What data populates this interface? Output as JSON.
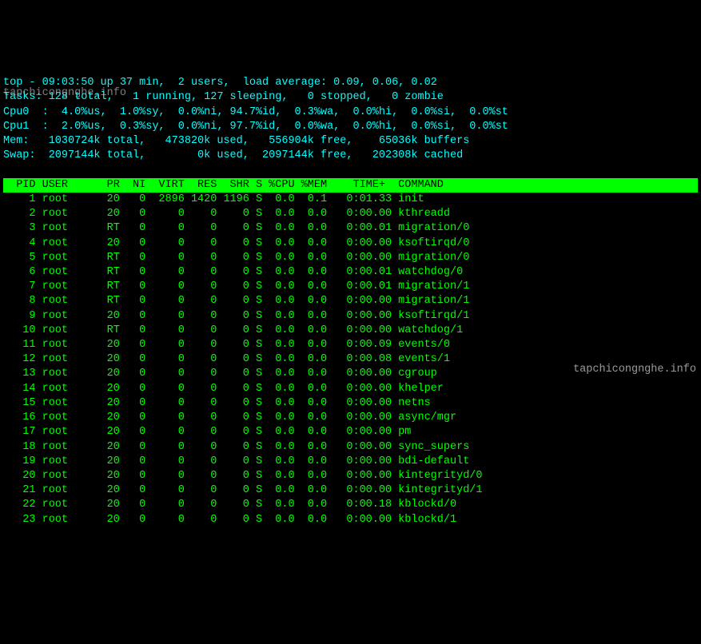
{
  "summary": {
    "line1": "top - 09:03:50 up 37 min,  2 users,  load average: 0.09, 0.06, 0.02",
    "line2": "Tasks: 128 total,   1 running, 127 sleeping,   0 stopped,   0 zombie",
    "line3": "Cpu0  :  4.0%us,  1.0%sy,  0.0%ni, 94.7%id,  0.3%wa,  0.0%hi,  0.0%si,  0.0%st",
    "line4": "Cpu1  :  2.0%us,  0.3%sy,  0.0%ni, 97.7%id,  0.0%wa,  0.0%hi,  0.0%si,  0.0%st",
    "line5": "Mem:   1030724k total,   473820k used,   556904k free,    65036k buffers",
    "line6": "Swap:  2097144k total,        0k used,  2097144k free,   202308k cached"
  },
  "header": "  PID USER      PR  NI  VIRT  RES  SHR S %CPU %MEM    TIME+  COMMAND           ",
  "rows": [
    {
      "pid": "1",
      "user": "root",
      "pr": "20",
      "ni": "0",
      "virt": "2896",
      "res": "1420",
      "shr": "1196",
      "s": "S",
      "cpu": "0.0",
      "mem": "0.1",
      "time": "0:01.33",
      "cmd": "init"
    },
    {
      "pid": "2",
      "user": "root",
      "pr": "20",
      "ni": "0",
      "virt": "0",
      "res": "0",
      "shr": "0",
      "s": "S",
      "cpu": "0.0",
      "mem": "0.0",
      "time": "0:00.00",
      "cmd": "kthreadd"
    },
    {
      "pid": "3",
      "user": "root",
      "pr": "RT",
      "ni": "0",
      "virt": "0",
      "res": "0",
      "shr": "0",
      "s": "S",
      "cpu": "0.0",
      "mem": "0.0",
      "time": "0:00.01",
      "cmd": "migration/0"
    },
    {
      "pid": "4",
      "user": "root",
      "pr": "20",
      "ni": "0",
      "virt": "0",
      "res": "0",
      "shr": "0",
      "s": "S",
      "cpu": "0.0",
      "mem": "0.0",
      "time": "0:00.00",
      "cmd": "ksoftirqd/0"
    },
    {
      "pid": "5",
      "user": "root",
      "pr": "RT",
      "ni": "0",
      "virt": "0",
      "res": "0",
      "shr": "0",
      "s": "S",
      "cpu": "0.0",
      "mem": "0.0",
      "time": "0:00.00",
      "cmd": "migration/0"
    },
    {
      "pid": "6",
      "user": "root",
      "pr": "RT",
      "ni": "0",
      "virt": "0",
      "res": "0",
      "shr": "0",
      "s": "S",
      "cpu": "0.0",
      "mem": "0.0",
      "time": "0:00.01",
      "cmd": "watchdog/0"
    },
    {
      "pid": "7",
      "user": "root",
      "pr": "RT",
      "ni": "0",
      "virt": "0",
      "res": "0",
      "shr": "0",
      "s": "S",
      "cpu": "0.0",
      "mem": "0.0",
      "time": "0:00.01",
      "cmd": "migration/1"
    },
    {
      "pid": "8",
      "user": "root",
      "pr": "RT",
      "ni": "0",
      "virt": "0",
      "res": "0",
      "shr": "0",
      "s": "S",
      "cpu": "0.0",
      "mem": "0.0",
      "time": "0:00.00",
      "cmd": "migration/1"
    },
    {
      "pid": "9",
      "user": "root",
      "pr": "20",
      "ni": "0",
      "virt": "0",
      "res": "0",
      "shr": "0",
      "s": "S",
      "cpu": "0.0",
      "mem": "0.0",
      "time": "0:00.00",
      "cmd": "ksoftirqd/1"
    },
    {
      "pid": "10",
      "user": "root",
      "pr": "RT",
      "ni": "0",
      "virt": "0",
      "res": "0",
      "shr": "0",
      "s": "S",
      "cpu": "0.0",
      "mem": "0.0",
      "time": "0:00.00",
      "cmd": "watchdog/1"
    },
    {
      "pid": "11",
      "user": "root",
      "pr": "20",
      "ni": "0",
      "virt": "0",
      "res": "0",
      "shr": "0",
      "s": "S",
      "cpu": "0.0",
      "mem": "0.0",
      "time": "0:00.09",
      "cmd": "events/0"
    },
    {
      "pid": "12",
      "user": "root",
      "pr": "20",
      "ni": "0",
      "virt": "0",
      "res": "0",
      "shr": "0",
      "s": "S",
      "cpu": "0.0",
      "mem": "0.0",
      "time": "0:00.08",
      "cmd": "events/1"
    },
    {
      "pid": "13",
      "user": "root",
      "pr": "20",
      "ni": "0",
      "virt": "0",
      "res": "0",
      "shr": "0",
      "s": "S",
      "cpu": "0.0",
      "mem": "0.0",
      "time": "0:00.00",
      "cmd": "cgroup"
    },
    {
      "pid": "14",
      "user": "root",
      "pr": "20",
      "ni": "0",
      "virt": "0",
      "res": "0",
      "shr": "0",
      "s": "S",
      "cpu": "0.0",
      "mem": "0.0",
      "time": "0:00.00",
      "cmd": "khelper"
    },
    {
      "pid": "15",
      "user": "root",
      "pr": "20",
      "ni": "0",
      "virt": "0",
      "res": "0",
      "shr": "0",
      "s": "S",
      "cpu": "0.0",
      "mem": "0.0",
      "time": "0:00.00",
      "cmd": "netns"
    },
    {
      "pid": "16",
      "user": "root",
      "pr": "20",
      "ni": "0",
      "virt": "0",
      "res": "0",
      "shr": "0",
      "s": "S",
      "cpu": "0.0",
      "mem": "0.0",
      "time": "0:00.00",
      "cmd": "async/mgr"
    },
    {
      "pid": "17",
      "user": "root",
      "pr": "20",
      "ni": "0",
      "virt": "0",
      "res": "0",
      "shr": "0",
      "s": "S",
      "cpu": "0.0",
      "mem": "0.0",
      "time": "0:00.00",
      "cmd": "pm"
    },
    {
      "pid": "18",
      "user": "root",
      "pr": "20",
      "ni": "0",
      "virt": "0",
      "res": "0",
      "shr": "0",
      "s": "S",
      "cpu": "0.0",
      "mem": "0.0",
      "time": "0:00.00",
      "cmd": "sync_supers"
    },
    {
      "pid": "19",
      "user": "root",
      "pr": "20",
      "ni": "0",
      "virt": "0",
      "res": "0",
      "shr": "0",
      "s": "S",
      "cpu": "0.0",
      "mem": "0.0",
      "time": "0:00.00",
      "cmd": "bdi-default"
    },
    {
      "pid": "20",
      "user": "root",
      "pr": "20",
      "ni": "0",
      "virt": "0",
      "res": "0",
      "shr": "0",
      "s": "S",
      "cpu": "0.0",
      "mem": "0.0",
      "time": "0:00.00",
      "cmd": "kintegrityd/0"
    },
    {
      "pid": "21",
      "user": "root",
      "pr": "20",
      "ni": "0",
      "virt": "0",
      "res": "0",
      "shr": "0",
      "s": "S",
      "cpu": "0.0",
      "mem": "0.0",
      "time": "0:00.00",
      "cmd": "kintegrityd/1"
    },
    {
      "pid": "22",
      "user": "root",
      "pr": "20",
      "ni": "0",
      "virt": "0",
      "res": "0",
      "shr": "0",
      "s": "S",
      "cpu": "0.0",
      "mem": "0.0",
      "time": "0:00.18",
      "cmd": "kblockd/0"
    },
    {
      "pid": "23",
      "user": "root",
      "pr": "20",
      "ni": "0",
      "virt": "0",
      "res": "0",
      "shr": "0",
      "s": "S",
      "cpu": "0.0",
      "mem": "0.0",
      "time": "0:00.00",
      "cmd": "kblockd/1"
    }
  ],
  "watermark": "tapchicongnghe.info"
}
